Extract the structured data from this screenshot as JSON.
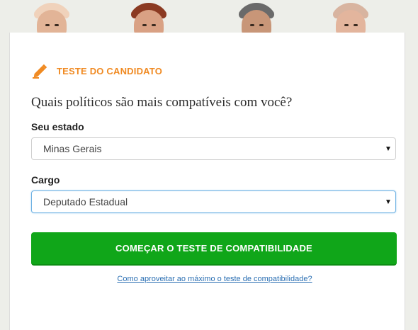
{
  "header": {
    "faces": [
      {
        "name": "candidate-face-1",
        "skin": "#e2b497",
        "hair": "#f0d2bb"
      },
      {
        "name": "candidate-face-2",
        "skin": "#d9a184",
        "hair": "#8b3a22"
      },
      {
        "name": "candidate-face-3",
        "skin": "#c89678",
        "hair": "#6a6a6a"
      },
      {
        "name": "candidate-face-4",
        "skin": "#e3b59d",
        "hair": "#d8b4a0"
      }
    ]
  },
  "badge": {
    "icon": "pencil-icon",
    "label": "TESTE DO CANDIDATO",
    "color": "#f08a22"
  },
  "form": {
    "question": "Quais políticos são mais compatíveis com você?",
    "state_label": "Seu estado",
    "state_value": "Minas Gerais",
    "office_label": "Cargo",
    "office_value": "Deputado Estadual",
    "arrow": "▼"
  },
  "actions": {
    "start_label": "COMEÇAR O TESTE DE COMPATIBILIDADE",
    "start_color": "#10a619",
    "help_link": "Como aproveitar ao máximo o teste de compatibilidade?"
  }
}
